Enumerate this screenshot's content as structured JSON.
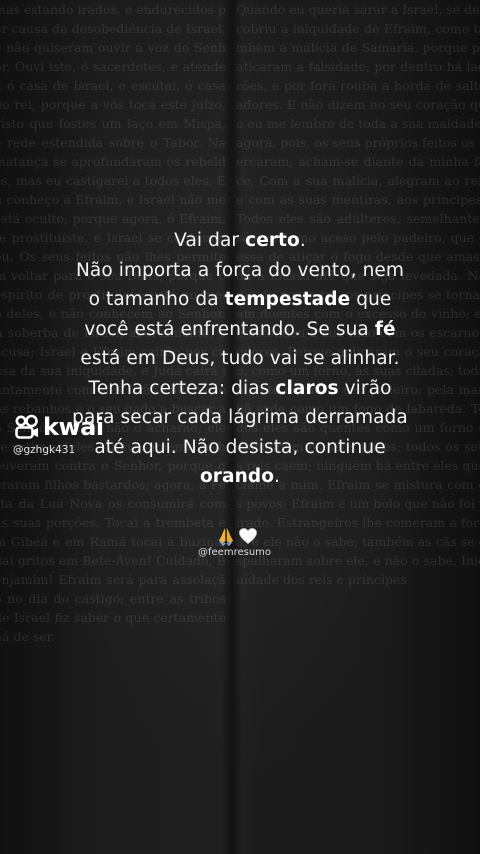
{
  "quote": {
    "l1_a": "Vai dar ",
    "l1_b": "certo",
    "l1_c": ".",
    "l2": "Não importa a força do vento, nem",
    "l3_a": "o tamanho da ",
    "l3_b": "tempestade",
    "l3_c": " que",
    "l4_a": "você está enfrentando. Se sua ",
    "l4_b": "fé",
    "l5": "está em Deus, tudo vai se alinhar.",
    "l6_a": "Tenha certeza: dias ",
    "l6_b": "claros",
    "l6_c": " virão",
    "l7": "para secar cada lágrima derramada",
    "l8": "até aqui. Não desista, continue",
    "l9_a": "orando",
    "l9_b": "."
  },
  "watermark": {
    "brand": "kwai",
    "username": "@gzhgk431"
  },
  "signature": {
    "emojis": "🙏🤍",
    "handle": "@feemresumo"
  },
  "background": {
    "left_text": "mas estando irados, e endurecidos por causa da desobediência de Israel, e não quiseram ouvir a voz do Senhor. Ouvi isto, ó sacerdotes, e atendei, ó casa de Israel, e escutai, ó casa do rei, porque a vós toca este juízo, visto que fostes um laço em Mispa, e rede estendida sobre o Tabor. Na matança se aprofundaram os rebeldes, mas eu castigarei a todos eles. Eu conheço a Efraim, e Israel não me está oculto; porque agora, ó Efraim, te prostituíste, e Israel se contaminou. Os seus feitos não lhes permitem voltar para o seu Deus, porque o espírito de prostituição está no meio deles, e não conhecem ao Senhor. A soberba de Israel, abertamente, o acusa; Israel e Efraim cairão por causa da sua iniquidade, e Judá cairá juntamente com eles. Irão com os seus rebanhos e o seu gado a buscar ao Senhor, porém não o acharão; ele se retirou deles. Aleivosamente se houveram contra o Senhor, porque geraram filhos bastardos; agora, a Festa da Lua Nova os consumirá com as suas porções. Tocai a trombeta em Gibeá e em Ramá tocai a buzina; dai gritos em Bete-Áven! Cuidado, Benjamim! Efraim será para assolação no dia do castigo; entre as tribos de Israel fiz saber o que certamente há de ser.",
    "right_text": "Quando eu queria sarar a Israel, se descobriu a iniquidade de Efraim, como também a malícia de Samaria, porque praticaram a falsidade; por dentro há ladrões, e por fora rouba a horda de salteadores. E não dizem no seu coração que eu me lembro de toda a sua maldade; agora, pois, os seus próprios feitos os cercaram; acham-se diante da minha face. Com a sua malícia, alegram ao rei, e com as suas mentiras, aos príncipes. Todos eles são adúlteros; semelhantes são ao forno aceso pelo padeiro, que cessa de atiçar o fogo desde que amassou a massa até que seja levedada. No dia do nosso rei, os príncipes se tornaram doentes com o excesso do vinho; ele estendeu a sua mão com os escarnecedores. Porque aplicaram o seu coração, como um forno, às suas ciladas; toda a noite dorme o seu padeiro; pela manhã arde como um fogo de labareda. Todos eles são quentes como um forno e consomem os seus juízes; todos os seus reis caem; ninguém há entre eles que clame a mim. Efraim se mistura com os povos; Efraim é um bolo que não foi virado. Estrangeiros lhe comeram a força, e ele não o sabe; também as cãs se espalharam sobre ele, e não o sabe. Iniquidade dos reis e príncipes"
  }
}
